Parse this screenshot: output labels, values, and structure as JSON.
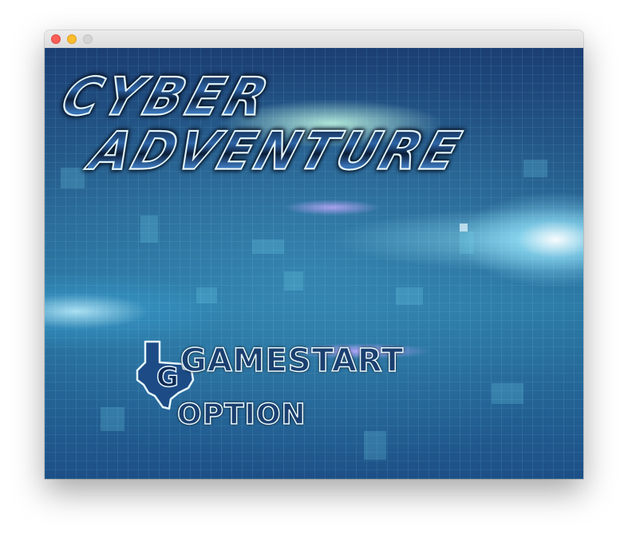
{
  "window": {
    "controls": {
      "close": "close-button",
      "minimize": "minimize-button",
      "maximize": "maximize-button"
    }
  },
  "game": {
    "logo": {
      "line1": "CYBER",
      "line2": "ADVENTURE"
    },
    "menu": {
      "items": [
        {
          "label": "GAMESTART",
          "selected": true
        },
        {
          "label": "OPTION",
          "selected": false
        }
      ]
    },
    "cursor_icon": "texas-shaped-selector-icon",
    "colors": {
      "logo_fill": "#1f4f86",
      "logo_outline": "#e9fbff",
      "menu_fill": "#1b3f6f",
      "background_primary": "#2a6a98"
    }
  }
}
